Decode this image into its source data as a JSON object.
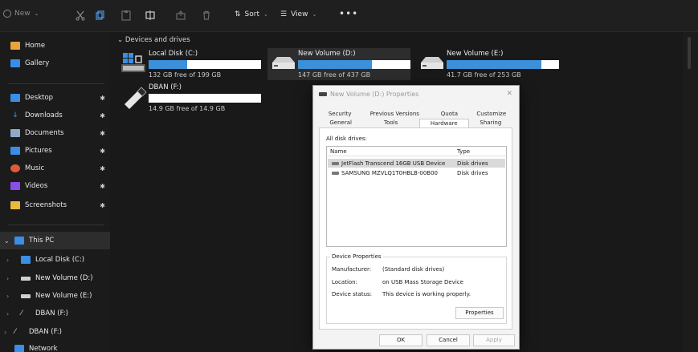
{
  "toolbar": {
    "new_label": "New",
    "sort_label": "Sort",
    "view_label": "View",
    "more_label": "•••"
  },
  "sidebar": {
    "items": [
      {
        "label": "Home",
        "icon": "home-icon",
        "color": "#e8a43b"
      },
      {
        "label": "Gallery",
        "icon": "gallery-icon",
        "color": "#3a8ee6"
      },
      {
        "label": "Desktop",
        "icon": "desktop-icon",
        "color": "#3a8ee6"
      },
      {
        "label": "Downloads",
        "icon": "download-icon",
        "color": "#3aa6e6"
      },
      {
        "label": "Documents",
        "icon": "documents-icon",
        "color": "#8fa9c9"
      },
      {
        "label": "Pictures",
        "icon": "pictures-icon",
        "color": "#3a8ee6"
      },
      {
        "label": "Music",
        "icon": "music-icon",
        "color": "#e05a3a"
      },
      {
        "label": "Videos",
        "icon": "videos-icon",
        "color": "#8a4de6"
      },
      {
        "label": "Screenshots",
        "icon": "folder-icon",
        "color": "#e8b93b"
      },
      {
        "label": "This PC",
        "icon": "pc-icon",
        "color": "#3a8ee6"
      },
      {
        "label": "Local Disk (C:)",
        "icon": "local-disk-icon",
        "color": "#3a8ee6"
      },
      {
        "label": "New Volume (D:)",
        "icon": "drive-icon",
        "color": "#d0d0d0"
      },
      {
        "label": "New Volume (E:)",
        "icon": "drive-icon",
        "color": "#d0d0d0"
      },
      {
        "label": "DBAN (F:)",
        "icon": "usb-icon",
        "color": "#d0d0d0"
      },
      {
        "label": "DBAN (F:)",
        "icon": "usb-icon",
        "color": "#d0d0d0"
      },
      {
        "label": "Network",
        "icon": "network-icon",
        "color": "#3a8ee6"
      }
    ]
  },
  "main": {
    "section_title": "Devices and drives",
    "drives": [
      {
        "name": "Local Disk (C:)",
        "free": "132 GB free of 199 GB",
        "used_fraction": 0.34
      },
      {
        "name": "New Volume (D:)",
        "free": "147 GB free of 437 GB",
        "used_fraction": 0.66
      },
      {
        "name": "New Volume (E:)",
        "free": "41.7 GB free of 253 GB",
        "used_fraction": 0.84
      },
      {
        "name": "DBAN (F:)",
        "free": "14.9 GB free of 14.9 GB",
        "used_fraction": 0.0
      }
    ]
  },
  "dialog": {
    "title": "New Volume (D:) Properties",
    "close": "✕",
    "tabs_top": [
      "Security",
      "Previous Versions",
      "Quota",
      "Customize"
    ],
    "tabs_bottom": [
      "General",
      "Tools",
      "Hardware",
      "Sharing"
    ],
    "all_disk_drives_label": "All disk drives:",
    "columns": [
      "Name",
      "Type"
    ],
    "rows": [
      {
        "name": "JetFlash Transcend 16GB USB Device",
        "type": "Disk drives"
      },
      {
        "name": "SAMSUNG MZVLQ1T0HBLB-00B00",
        "type": "Disk drives"
      }
    ],
    "device_properties": {
      "title": "Device Properties",
      "manufacturer_key": "Manufacturer:",
      "manufacturer_val": "(Standard disk drives)",
      "location_key": "Location:",
      "location_val": "on USB Mass Storage Device",
      "status_key": "Device status:",
      "status_val": "This device is working properly.",
      "properties_button": "Properties"
    },
    "ok": "OK",
    "cancel": "Cancel",
    "apply": "Apply"
  }
}
